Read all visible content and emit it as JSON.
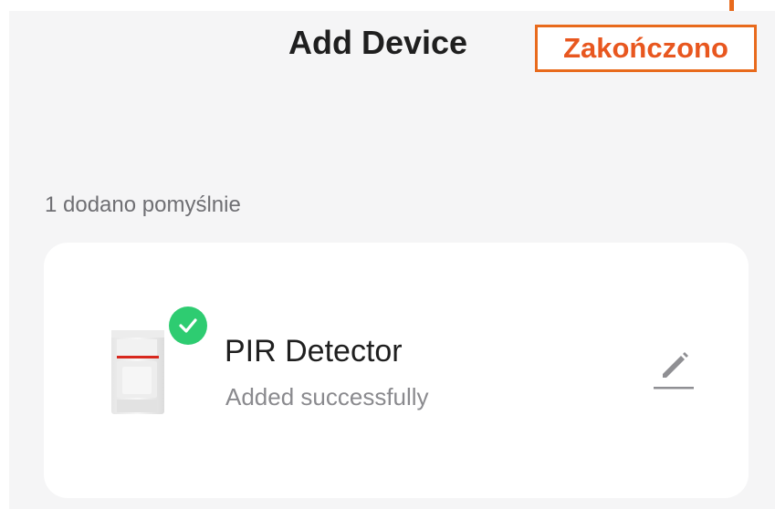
{
  "header": {
    "title": "Add Device",
    "done_label": "Zakończono"
  },
  "section": {
    "label": "1 dodano pomyślnie"
  },
  "device": {
    "name": "PIR Detector",
    "status": "Added successfully",
    "image_icon": "pir-detector-icon",
    "badge_icon": "check-icon",
    "edit_icon": "pencil-icon"
  },
  "colors": {
    "accent": "#e8571f",
    "success": "#2ecc71",
    "background": "#f5f5f6",
    "card": "#ffffff"
  }
}
